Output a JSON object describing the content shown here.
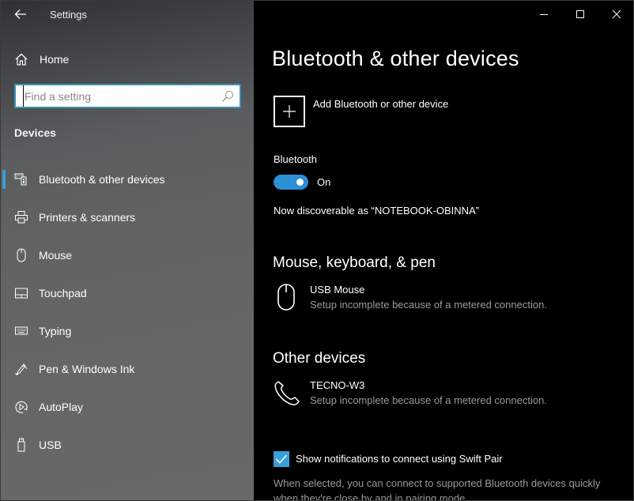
{
  "app": {
    "title": "Settings"
  },
  "sidebar": {
    "home_label": "Home",
    "search": {
      "placeholder": "Find a setting",
      "value": ""
    },
    "section_title": "Devices",
    "items": [
      {
        "label": "Bluetooth & other devices",
        "icon": "bluetooth-devices-icon",
        "selected": true
      },
      {
        "label": "Printers & scanners",
        "icon": "printer-icon",
        "selected": false
      },
      {
        "label": "Mouse",
        "icon": "mouse-icon",
        "selected": false
      },
      {
        "label": "Touchpad",
        "icon": "touchpad-icon",
        "selected": false
      },
      {
        "label": "Typing",
        "icon": "keyboard-icon",
        "selected": false
      },
      {
        "label": "Pen & Windows Ink",
        "icon": "pen-icon",
        "selected": false
      },
      {
        "label": "AutoPlay",
        "icon": "autoplay-icon",
        "selected": false
      },
      {
        "label": "USB",
        "icon": "usb-icon",
        "selected": false
      }
    ]
  },
  "window_controls": {
    "minimize": "minimize",
    "maximize": "maximize",
    "close": "close"
  },
  "main": {
    "page_title": "Bluetooth & other devices",
    "add_device_label": "Add Bluetooth or other device",
    "bluetooth": {
      "label": "Bluetooth",
      "state": "On",
      "enabled": true,
      "discoverable_text": "Now discoverable as “NOTEBOOK-OBINNA”"
    },
    "groups": [
      {
        "title": "Mouse, keyboard, & pen",
        "devices": [
          {
            "name": "USB Mouse",
            "status": "Setup incomplete because of a metered connection.",
            "icon": "mouse-icon"
          }
        ]
      },
      {
        "title": "Other devices",
        "devices": [
          {
            "name": "TECNO-W3",
            "status": "Setup incomplete because of a metered connection.",
            "icon": "phone-icon"
          }
        ]
      }
    ],
    "swift_pair": {
      "label": "Show notifications to connect using Swift Pair",
      "checked": true,
      "description": "When selected, you can connect to supported Bluetooth devices quickly when they're close by and in pairing mode."
    }
  },
  "colors": {
    "accent": "#3a9fd8",
    "toggle_on": "#2d8fd5",
    "search_border": "#3d8eb5",
    "secondary_text": "#9a9a9a",
    "main_bg": "#000000"
  }
}
